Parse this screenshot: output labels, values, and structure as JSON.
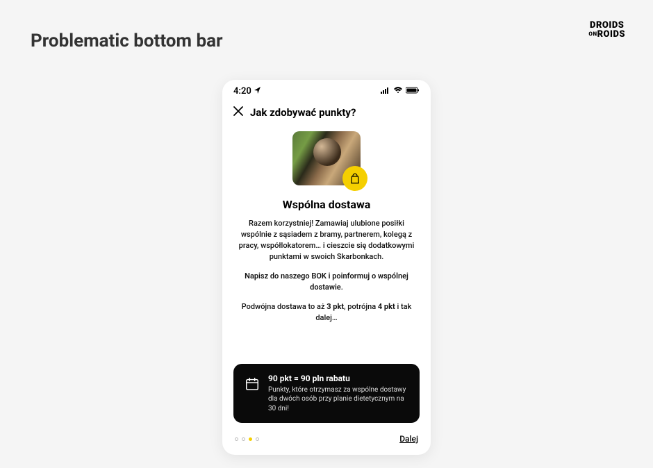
{
  "slide": {
    "title": "Problematic bottom bar"
  },
  "logo": {
    "line1": "DROIDS",
    "on": "ON",
    "line2": "ROIDS"
  },
  "statusBar": {
    "time": "4:20"
  },
  "header": {
    "title": "Jak zdobywać punkty?"
  },
  "hero": {
    "sectionTitle": "Wspólna dostawa"
  },
  "body": {
    "para1": "Razem korzystniej! Zamawiaj ulubione posiłki wspólnie z sąsiadem z bramy, partnerem, kolegą z pracy, współlokatorem… i cieszcie się dodatkowymi punktami w swoich Skarbonkach.",
    "para2": "Napisz do naszego BOK i poinformuj o wspólnej dostawie.",
    "para3_pre": "Podwójna dostawa to aż ",
    "para3_pts1": "3 pkt",
    "para3_mid": ", potrójna ",
    "para3_pts2": "4 pkt",
    "para3_post": " i tak dalej…"
  },
  "card": {
    "title": "90 pkt = 90 pln rabatu",
    "text": "Punkty, które otrzymasz za wspólne dostawy dla dwóch osób przy planie dietetycznym na 30 dni!"
  },
  "footer": {
    "next": "Dalej"
  }
}
